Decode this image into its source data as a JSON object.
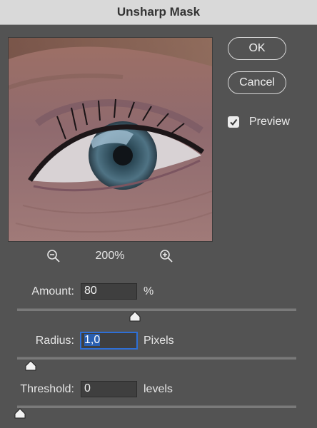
{
  "window": {
    "title": "Unsharp Mask"
  },
  "buttons": {
    "ok": "OK",
    "cancel": "Cancel"
  },
  "preview": {
    "label": "Preview",
    "checked": true
  },
  "zoom": {
    "level": "200%"
  },
  "controls": [
    {
      "label": "Amount:",
      "value": "80",
      "unit": "%",
      "slider_fraction": 0.43
    },
    {
      "label": "Radius:",
      "value": "1,0",
      "unit": "Pixels",
      "slider_fraction": 0.04
    },
    {
      "label": "Threshold:",
      "value": "0",
      "unit": "levels",
      "slider_fraction": 0.0
    }
  ]
}
